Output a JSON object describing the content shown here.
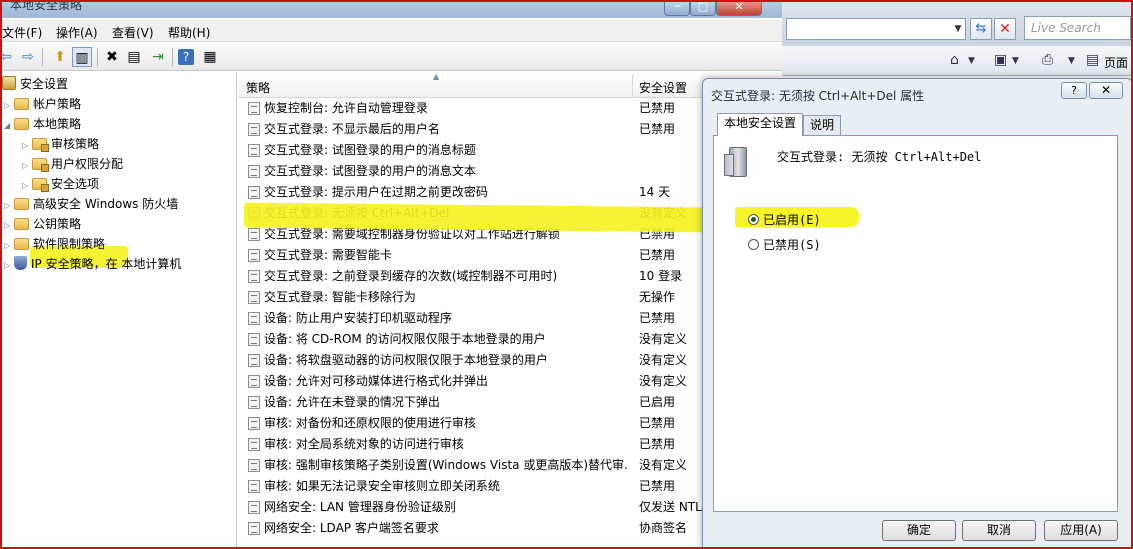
{
  "window": {
    "title": "本地安全策略",
    "min_glyph": "─",
    "max_glyph": "□",
    "close_glyph": "✕"
  },
  "menu": [
    "文件(F)",
    "操作(A)",
    "查看(V)",
    "帮助(H)"
  ],
  "tree": {
    "items": [
      {
        "label": "安全设置",
        "level": 0,
        "icon": "root-icon"
      },
      {
        "label": "帐户策略",
        "level": 1,
        "icon": "folder-icon"
      },
      {
        "label": "本地策略",
        "level": 1,
        "icon": "folder-icon"
      },
      {
        "label": "审核策略",
        "level": 2,
        "icon": "folder-lock-icon"
      },
      {
        "label": "用户权限分配",
        "level": 2,
        "icon": "folder-lock-icon"
      },
      {
        "label": "安全选项",
        "level": 2,
        "icon": "folder-lock-icon"
      },
      {
        "label": "高级安全 Windows 防火墙",
        "level": 1,
        "icon": "folder-icon"
      },
      {
        "label": "公钥策略",
        "level": 1,
        "icon": "folder-icon"
      },
      {
        "label": "软件限制策略",
        "level": 1,
        "icon": "folder-icon"
      },
      {
        "label": "IP 安全策略，在 本地计算机",
        "level": 1,
        "icon": "shield-icon"
      }
    ]
  },
  "list": {
    "col_policy": "策略",
    "col_setting": "安全设置",
    "rows": [
      {
        "name": "恢复控制台: 允许自动管理登录",
        "setting": "已禁用"
      },
      {
        "name": "交互式登录: 不显示最后的用户名",
        "setting": "已禁用"
      },
      {
        "name": "交互式登录: 试图登录的用户的消息标题",
        "setting": ""
      },
      {
        "name": "交互式登录: 试图登录的用户的消息文本",
        "setting": ""
      },
      {
        "name": "交互式登录: 提示用户在过期之前更改密码",
        "setting": "14 天"
      },
      {
        "name": "交互式登录: 无须按 Ctrl+Alt+Del",
        "setting": "没有定义"
      },
      {
        "name": "交互式登录: 需要域控制器身份验证以对工作站进行解锁",
        "setting": "已禁用"
      },
      {
        "name": "交互式登录: 需要智能卡",
        "setting": "已禁用"
      },
      {
        "name": "交互式登录: 之前登录到缓存的次数(域控制器不可用时)",
        "setting": "10 登录"
      },
      {
        "name": "交互式登录: 智能卡移除行为",
        "setting": "无操作"
      },
      {
        "name": "设备: 防止用户安装打印机驱动程序",
        "setting": "已禁用"
      },
      {
        "name": "设备: 将 CD-ROM 的访问权限仅限于本地登录的用户",
        "setting": "没有定义"
      },
      {
        "name": "设备: 将软盘驱动器的访问权限仅限于本地登录的用户",
        "setting": "没有定义"
      },
      {
        "name": "设备: 允许对可移动媒体进行格式化并弹出",
        "setting": "没有定义"
      },
      {
        "name": "设备: 允许在未登录的情况下弹出",
        "setting": "已启用"
      },
      {
        "name": "审核: 对备份和还原权限的使用进行审核",
        "setting": "已禁用"
      },
      {
        "name": "审核: 对全局系统对象的访问进行审核",
        "setting": "已禁用"
      },
      {
        "name": "审核: 强制审核策略子类别设置(Windows Vista 或更高版本)替代审...",
        "setting": "没有定义"
      },
      {
        "name": "审核: 如果无法记录安全审核则立即关闭系统",
        "setting": "已禁用"
      },
      {
        "name": "网络安全: LAN 管理器身份验证级别",
        "setting": "仅发送 NTL"
      },
      {
        "name": "网络安全: LDAP 客户端签名要求",
        "setting": "协商签名"
      }
    ]
  },
  "ie": {
    "search_placeholder": "Live Search",
    "page_label": "页面"
  },
  "dialog": {
    "title": "交互式登录: 无须按 Ctrl+Alt+Del 属性",
    "help_glyph": "?",
    "close_glyph": "✕",
    "tabs": [
      "本地安全设置",
      "说明"
    ],
    "policy_name": "交互式登录: 无须按 Ctrl+Alt+Del",
    "options": [
      {
        "label": "已启用(E)",
        "selected": true
      },
      {
        "label": "已禁用(S)",
        "selected": false
      }
    ],
    "buttons": [
      "确定",
      "取消",
      "应用(A)"
    ]
  },
  "colors": {
    "highlight": "#f5f21e",
    "frame": "#d01010"
  }
}
